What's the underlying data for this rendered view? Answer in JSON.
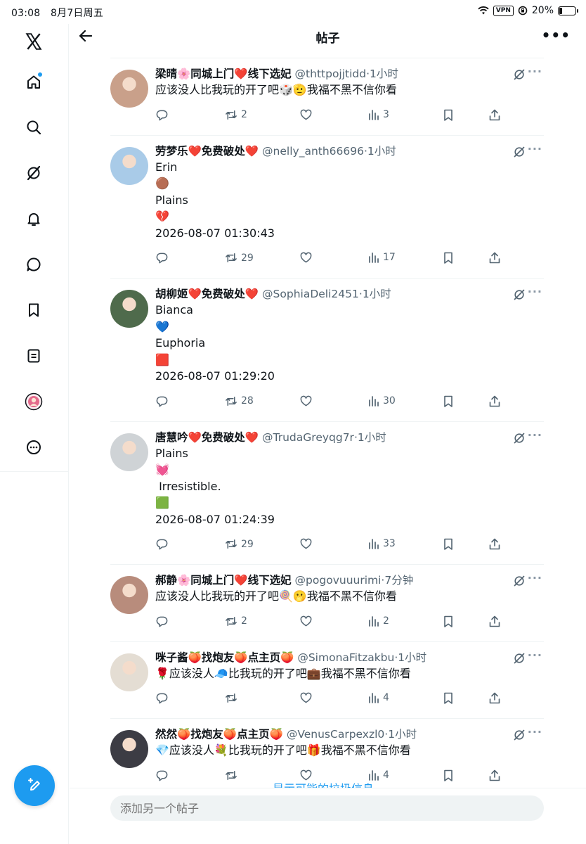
{
  "status_bar": {
    "time": "03:08",
    "date": "8月7日周五",
    "vpn": "VPN",
    "battery": "20%",
    "battery_level": 0.2
  },
  "header": {
    "title": "帖子"
  },
  "sidebar": {
    "items": [
      "x-logo",
      "home-icon",
      "search-icon",
      "grok-icon",
      "bell-icon",
      "messages-icon",
      "bookmark-icon",
      "lists-icon",
      "profile-avatar",
      "more-icon"
    ]
  },
  "posts": [
    {
      "name": "梁晴🌸同城上门❤️线下选妃",
      "handle": "@thttpojjtidd",
      "time": "1小时",
      "lines": [
        "应该没人比我玩的开了吧🎲🫡我福不黑不信你看"
      ],
      "replies": "",
      "reposts": "2",
      "likes": "",
      "views": "3",
      "avatar_color": "#c9a08a"
    },
    {
      "name": "劳梦乐❤️免费破处❤️",
      "handle": "@nelly_anth66696",
      "time": "1小时",
      "lines": [
        "Erin",
        "🟤",
        "Plains",
        "💔",
        "2026-08-07 01:30:43"
      ],
      "replies": "",
      "reposts": "29",
      "likes": "",
      "views": "17",
      "avatar_color": "#a9cbe8"
    },
    {
      "name": "胡柳姬❤️免费破处❤️",
      "handle": "@SophiaDeli2451",
      "time": "1小时",
      "lines": [
        "Bianca",
        "💙",
        "Euphoria",
        "🟥",
        "2026-08-07 01:29:20"
      ],
      "replies": "",
      "reposts": "28",
      "likes": "",
      "views": "30",
      "avatar_color": "#4f6b4c"
    },
    {
      "name": "唐慧吟❤️免费破处❤️",
      "handle": "@TrudaGreyqg7r",
      "time": "1小时",
      "lines": [
        "Plains",
        "💓",
        " Irresistible.",
        "🟩",
        "2026-08-07 01:24:39"
      ],
      "replies": "",
      "reposts": "29",
      "likes": "",
      "views": "33",
      "avatar_color": "#cfd3d6"
    },
    {
      "name": "郝静🌸同城上门❤️线下选妃",
      "handle": "@pogovuuurimi",
      "time": "7分钟",
      "lines": [
        "应该没人比我玩的开了吧🍭🫢我福不黑不信你看"
      ],
      "replies": "",
      "reposts": "2",
      "likes": "",
      "views": "2",
      "avatar_color": "#b88c7c"
    },
    {
      "name": "咪子酱🍑找炮友🍑点主页🍑",
      "handle": "@SimonaFitzakbu",
      "time": "1小时",
      "lines": [
        "🌹应该没人🧢比我玩的开了吧💼我福不黑不信你看"
      ],
      "replies": "",
      "reposts": "",
      "likes": "",
      "views": "4",
      "avatar_color": "#e4ddd3"
    },
    {
      "name": "然然🍑找炮友🍑点主页🍑",
      "handle": "@VenusCarpexzl0",
      "time": "1小时",
      "lines": [
        "💎应该没人💐比我玩的开了吧🎁我福不黑不信你看"
      ],
      "replies": "",
      "reposts": "",
      "likes": "",
      "views": "4",
      "avatar_color": "#3c3c44"
    }
  ],
  "spam_link": "显示可能的垃圾信息",
  "reply_placeholder": "添加另一个帖子",
  "colors": {
    "accent": "#1d9bf0",
    "secondary_text": "#536471",
    "divider": "#eff3f4"
  }
}
